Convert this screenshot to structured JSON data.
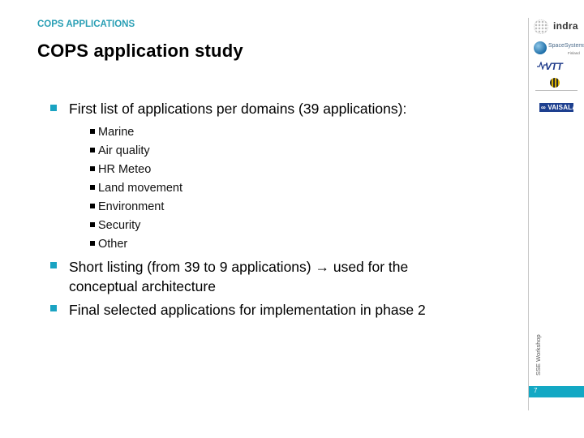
{
  "header": {
    "section_label": "COPS APPLICATIONS",
    "title": "COPS application study"
  },
  "content": {
    "bullets": [
      {
        "text": "First list of applications per domains (39 applications):",
        "sub_items": [
          "Marine",
          "Air quality",
          "HR Meteo",
          "Land movement",
          "Environment",
          "Security",
          "Other"
        ]
      },
      {
        "line1": "Short listing (from 39 to 9 applications) → used for the",
        "line2": "conceptual architecture"
      },
      {
        "text": "Final selected applications for implementation in phase 2"
      }
    ]
  },
  "sidebar": {
    "logos": [
      {
        "name": "indra",
        "text": "indra"
      },
      {
        "name": "space-systems-finland",
        "text": "SpaceSystems",
        "subtext": "Finland"
      },
      {
        "name": "vtt",
        "text": "VTT"
      },
      {
        "name": "fmi",
        "text": ""
      },
      {
        "name": "vaisala",
        "text": "∞ VAISALA"
      }
    ],
    "footer_text": "SSE Workshop",
    "page_number": "7"
  },
  "colors": {
    "accent": "#13a8c4",
    "section_label": "#2a9fb5",
    "bullet_l1": "#1aa3c2",
    "text": "#000000"
  }
}
